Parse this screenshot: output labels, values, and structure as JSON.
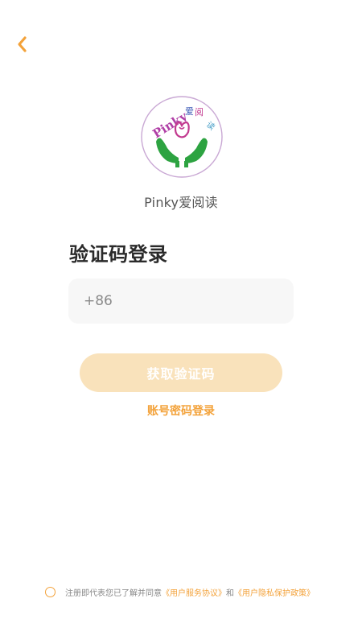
{
  "header": {
    "back_icon": "chevron-left-icon"
  },
  "brand": {
    "logo_text_en": "Pinky",
    "logo_text_cn": "爱阅读",
    "app_name": "Pinky爱阅读"
  },
  "login": {
    "title": "验证码登录",
    "country_code": "+86",
    "phone_value": "",
    "get_code_label": "获取验证码",
    "password_login_label": "账号密码登录"
  },
  "agreement": {
    "prefix": "注册即代表您已了解并同意",
    "user_agreement": "《用户服务协议》",
    "conjunction": "和",
    "privacy_policy": "《用户隐私保护政策》",
    "checked": false
  },
  "colors": {
    "accent": "#f3a23a",
    "button_disabled_bg": "#f9e2bb",
    "input_bg": "#f7f7f7",
    "title_text": "#2a2a2a",
    "muted_text": "#888888"
  }
}
